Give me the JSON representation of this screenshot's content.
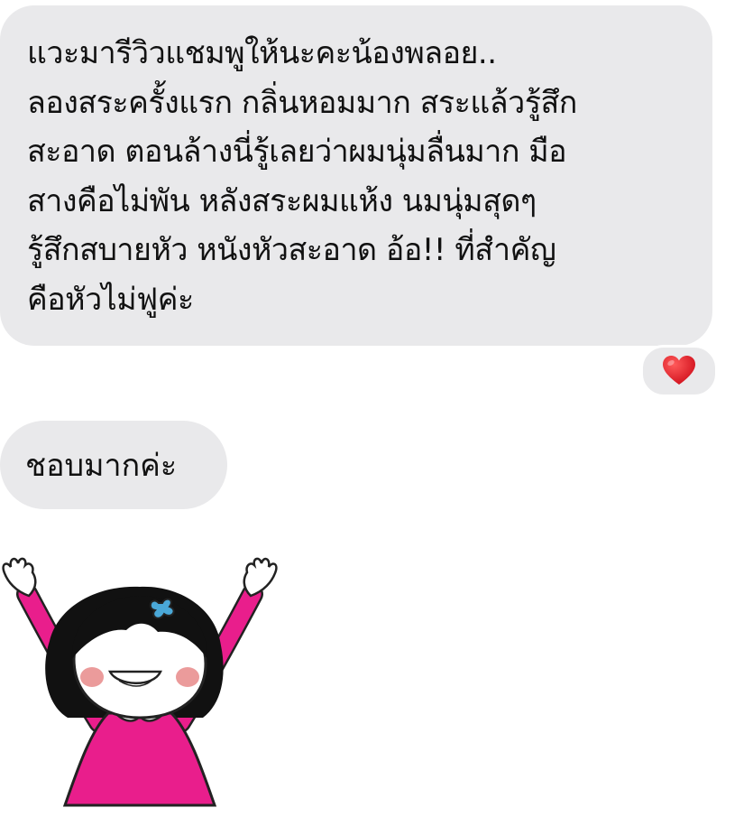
{
  "conversation": {
    "messages": [
      {
        "lines": [
          "แวะมารีวิวแชมพูให้นะคะน้องพลอย..",
          "ลองสระครั้งแรก กลิ่นหอมมาก สระแล้วรู้สึก",
          "สะอาด ตอนล้างนี่รู้เลยว่าผมนุ่มลื่นมาก มือ",
          "สางคือไม่พัน หลังสระผมแห้ง นมนุ่มสุดๆ",
          "รู้สึกสบายหัว หนังหัวสะอาด อ้อ!! ที่สำคัญ",
          "คือหัวไม่ฟูค่ะ"
        ]
      },
      {
        "text": "ชอบมากค่ะ"
      }
    ],
    "reaction": {
      "icon": "heart-icon",
      "color": "#e0202a"
    },
    "sticker": {
      "icon": "cheering-girl-sticker",
      "dress_color": "#e91e8c"
    }
  },
  "theme": {
    "bubble_color": "#e9e9eb",
    "text_color": "#111111",
    "background": "#ffffff"
  }
}
